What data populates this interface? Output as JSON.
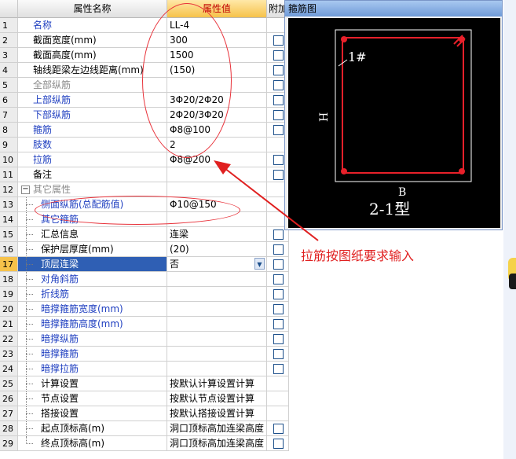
{
  "grid": {
    "header": {
      "num": "",
      "name": "属性名称",
      "value": "属性值",
      "extra": "附加"
    },
    "rows": [
      {
        "num": "1",
        "name": "名称",
        "value": "LL-4",
        "style": "blue",
        "check": false
      },
      {
        "num": "2",
        "name": "截面宽度(mm)",
        "value": "300",
        "style": "black",
        "check": true
      },
      {
        "num": "3",
        "name": "截面高度(mm)",
        "value": "1500",
        "style": "black",
        "check": true
      },
      {
        "num": "4",
        "name": "轴线距梁左边线距离(mm)",
        "value": "(150)",
        "style": "black",
        "check": true
      },
      {
        "num": "5",
        "name": "全部纵筋",
        "value": "",
        "style": "gray",
        "check": true
      },
      {
        "num": "6",
        "name": "上部纵筋",
        "value": "3Φ20/2Φ20",
        "style": "blue",
        "check": true
      },
      {
        "num": "7",
        "name": "下部纵筋",
        "value": "2Φ20/3Φ20",
        "style": "blue",
        "check": true
      },
      {
        "num": "8",
        "name": "箍筋",
        "value": "Φ8@100",
        "style": "blue",
        "check": true
      },
      {
        "num": "9",
        "name": "肢数",
        "value": "2",
        "style": "blue",
        "check": false
      },
      {
        "num": "10",
        "name": "拉筋",
        "value": "Φ8@200",
        "style": "blue",
        "check": true
      },
      {
        "num": "11",
        "name": "备注",
        "value": "",
        "style": "black",
        "check": true
      },
      {
        "num": "12",
        "name": "其它属性",
        "value": "",
        "style": "gray",
        "check": false,
        "expander": "−"
      },
      {
        "num": "13",
        "name": "侧面纵筋(总配筋值)",
        "value": "Φ10@150",
        "style": "blue",
        "check": false,
        "tree": "mid"
      },
      {
        "num": "14",
        "name": "其它箍筋",
        "value": "",
        "style": "blue",
        "check": false,
        "tree": "mid"
      },
      {
        "num": "15",
        "name": "汇总信息",
        "value": "连梁",
        "style": "black",
        "check": true,
        "tree": "mid"
      },
      {
        "num": "16",
        "name": "保护层厚度(mm)",
        "value": "(20)",
        "style": "black",
        "check": true,
        "tree": "mid"
      },
      {
        "num": "17",
        "name": "顶层连梁",
        "value": "否",
        "style": "black",
        "check": true,
        "tree": "mid",
        "selected": true
      },
      {
        "num": "18",
        "name": "对角斜筋",
        "value": "",
        "style": "blue",
        "check": true,
        "tree": "mid"
      },
      {
        "num": "19",
        "name": "折线筋",
        "value": "",
        "style": "blue",
        "check": true,
        "tree": "mid"
      },
      {
        "num": "20",
        "name": "暗撑箍筋宽度(mm)",
        "value": "",
        "style": "blue",
        "check": true,
        "tree": "mid"
      },
      {
        "num": "21",
        "name": "暗撑箍筋高度(mm)",
        "value": "",
        "style": "blue",
        "check": true,
        "tree": "mid"
      },
      {
        "num": "22",
        "name": "暗撑纵筋",
        "value": "",
        "style": "blue",
        "check": true,
        "tree": "mid"
      },
      {
        "num": "23",
        "name": "暗撑箍筋",
        "value": "",
        "style": "blue",
        "check": true,
        "tree": "mid"
      },
      {
        "num": "24",
        "name": "暗撑拉筋",
        "value": "",
        "style": "blue",
        "check": true,
        "tree": "mid"
      },
      {
        "num": "25",
        "name": "计算设置",
        "value": "按默认计算设置计算",
        "style": "black",
        "check": false,
        "tree": "mid"
      },
      {
        "num": "26",
        "name": "节点设置",
        "value": "按默认节点设置计算",
        "style": "black",
        "check": false,
        "tree": "mid"
      },
      {
        "num": "27",
        "name": "搭接设置",
        "value": "按默认搭接设置计算",
        "style": "black",
        "check": false,
        "tree": "mid"
      },
      {
        "num": "28",
        "name": "起点顶标高(m)",
        "value": "洞口顶标高加连梁高度",
        "style": "black",
        "check": true,
        "tree": "mid"
      },
      {
        "num": "29",
        "name": "终点顶标高(m)",
        "value": "洞口顶标高加连梁高度",
        "style": "black",
        "check": true,
        "tree": "end"
      }
    ]
  },
  "preview": {
    "title": "箍筋图",
    "label_rebar": "1#",
    "label_h": "H",
    "label_b": "B",
    "type_label": "2-1型"
  },
  "annotation": {
    "callout": "拉筋按图纸要求输入",
    "color": "#e02020"
  }
}
